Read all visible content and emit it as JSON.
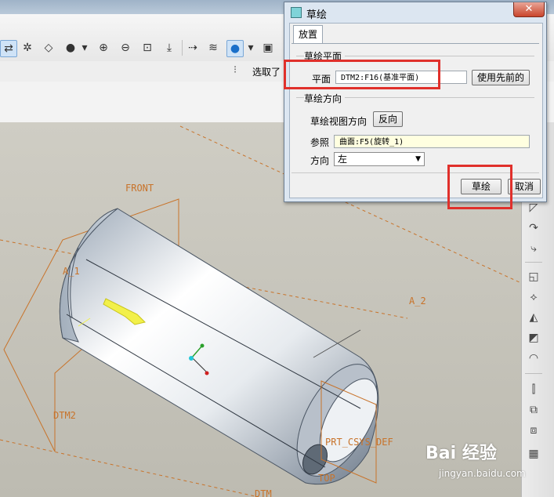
{
  "app": {
    "filter_label": "选取了",
    "toolbar_icons": [
      "snap-icon",
      "spin-center-icon",
      "plane-icon",
      "shade-icon",
      "dropdown-icon",
      "zoom-in-icon",
      "zoom-out-icon",
      "refit-icon",
      "reorient-icon",
      "datum-display-icon",
      "layers-icon",
      "display-style-icon",
      "dropdown-icon",
      "save-view-icon"
    ]
  },
  "dialog": {
    "title": "草绘",
    "tab": "放置",
    "sketch_plane": {
      "group_title": "草绘平面",
      "plane_label": "平面",
      "plane_value": "DTM2:F16(基准平面)",
      "use_previous_button": "使用先前的"
    },
    "orientation": {
      "group_title": "草绘方向",
      "view_direction_label": "草绘视图方向",
      "flip_button": "反向",
      "reference_label": "参照",
      "reference_value": "曲面:F5(旋转_1)",
      "direction_label": "方向",
      "direction_value": "左"
    },
    "sketch_button": "草绘",
    "cancel_button": "取消"
  },
  "viewport": {
    "labels": {
      "front": "FRONT",
      "a1": "A_1",
      "a2": "A_2",
      "dtm2": "DTM2",
      "prt_csys": "PRT_CSYS_DEF",
      "top": "TOP",
      "dtm_bottom": "DTM"
    }
  },
  "watermark": {
    "brand": "Bai 经验",
    "url": "jingyan.baidu.com"
  },
  "colors": {
    "highlight": "#e0302b",
    "datum": "#c8732a",
    "dialog_bg": "#dce6f1"
  }
}
